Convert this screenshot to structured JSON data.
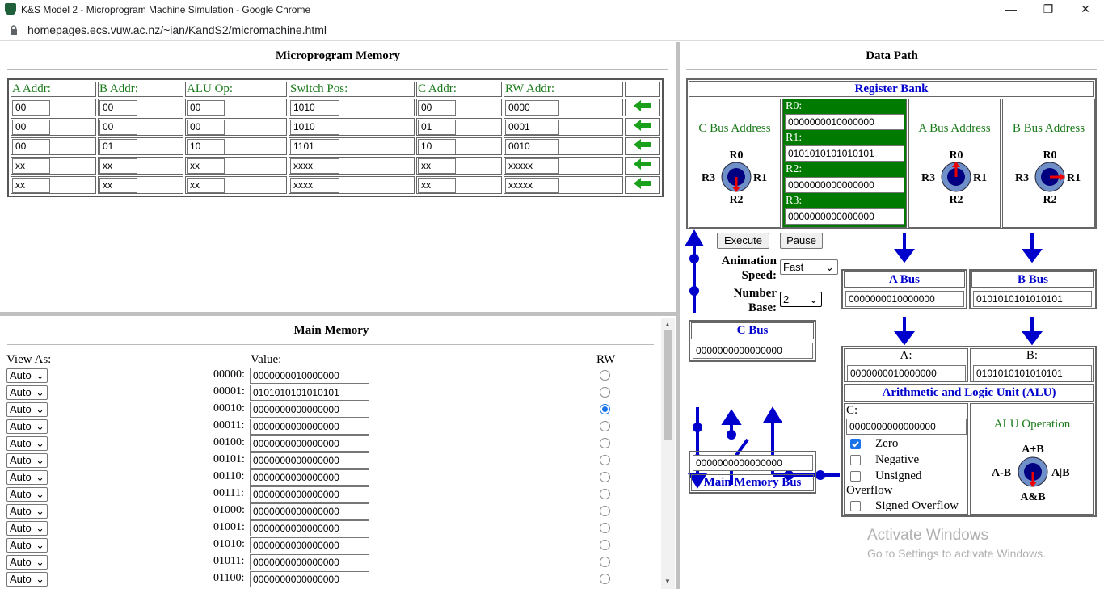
{
  "window": {
    "title": "K&S Model 2 - Microprogram Machine Simulation - Google Chrome",
    "url": "homepages.ecs.vuw.ac.nz/~ian/KandS2/micromachine.html"
  },
  "microprogram": {
    "title": "Microprogram Memory",
    "headers": [
      "A Addr:",
      "B Addr:",
      "ALU Op:",
      "Switch Pos:",
      "C Addr:",
      "RW Addr:"
    ],
    "rows": [
      [
        "00",
        "00",
        "00",
        "1010",
        "00",
        "0000"
      ],
      [
        "00",
        "00",
        "00",
        "1010",
        "01",
        "0001"
      ],
      [
        "00",
        "01",
        "10",
        "1101",
        "10",
        "0010"
      ],
      [
        "xx",
        "xx",
        "xx",
        "xxxx",
        "xx",
        "xxxxx"
      ],
      [
        "xx",
        "xx",
        "xx",
        "xxxx",
        "xx",
        "xxxxx"
      ]
    ]
  },
  "main_memory": {
    "title": "Main Memory",
    "view_as_label": "View As:",
    "value_label": "Value:",
    "rw_label": "RW",
    "rows": [
      {
        "view": "Auto",
        "addr": "00000:",
        "value": "0000000010000000",
        "rw": false
      },
      {
        "view": "Auto",
        "addr": "00001:",
        "value": "0101010101010101",
        "rw": false
      },
      {
        "view": "Auto",
        "addr": "00010:",
        "value": "0000000000000000",
        "rw": true
      },
      {
        "view": "Auto",
        "addr": "00011:",
        "value": "0000000000000000",
        "rw": false
      },
      {
        "view": "Auto",
        "addr": "00100:",
        "value": "0000000000000000",
        "rw": false
      },
      {
        "view": "Auto",
        "addr": "00101:",
        "value": "0000000000000000",
        "rw": false
      },
      {
        "view": "Auto",
        "addr": "00110:",
        "value": "0000000000000000",
        "rw": false
      },
      {
        "view": "Auto",
        "addr": "00111:",
        "value": "0000000000000000",
        "rw": false
      },
      {
        "view": "Auto",
        "addr": "01000:",
        "value": "0000000000000000",
        "rw": false
      },
      {
        "view": "Auto",
        "addr": "01001:",
        "value": "0000000000000000",
        "rw": false
      },
      {
        "view": "Auto",
        "addr": "01010:",
        "value": "0000000000000000",
        "rw": false
      },
      {
        "view": "Auto",
        "addr": "01011:",
        "value": "0000000000000000",
        "rw": false
      },
      {
        "view": "Auto",
        "addr": "01100:",
        "value": "0000000000000000",
        "rw": false
      }
    ]
  },
  "datapath": {
    "title": "Data Path",
    "register_bank": "Register Bank",
    "c_bus_address": "C Bus Address",
    "a_bus_address": "A Bus Address",
    "b_bus_address": "B Bus Address",
    "registers": [
      {
        "name": "R0:",
        "value": "0000000010000000"
      },
      {
        "name": "R1:",
        "value": "0101010101010101"
      },
      {
        "name": "R2:",
        "value": "0000000000000000"
      },
      {
        "name": "R3:",
        "value": "0000000000000000"
      }
    ],
    "dial_labels": {
      "top": "R0",
      "left": "R3",
      "right": "R1",
      "bottom": "R2"
    },
    "execute": "Execute",
    "pause": "Pause",
    "animation_speed_label_1": "Animation",
    "animation_speed_label_2": "Speed:",
    "animation_speed": "Fast",
    "number_base_label_1": "Number",
    "number_base_label_2": "Base:",
    "number_base": "2",
    "a_bus": {
      "label": "A Bus",
      "value": "0000000010000000"
    },
    "b_bus": {
      "label": "B Bus",
      "value": "0101010101010101"
    },
    "c_bus": {
      "label": "C Bus",
      "value": "0000000000000000"
    },
    "main_memory_bus": {
      "label": "Main Memory Bus",
      "value": "0000000000000000"
    },
    "a_reg": {
      "label": "A:",
      "value": "0000000010000000"
    },
    "b_reg": {
      "label": "B:",
      "value": "0101010101010101"
    },
    "alu": {
      "title": "Arithmetic and Logic Unit (ALU)",
      "c_label": "C:",
      "c_value": "0000000000000000",
      "flags": [
        {
          "label": "Zero",
          "checked": true
        },
        {
          "label": "Negative",
          "checked": false
        },
        {
          "label": "Unsigned",
          "checked": false
        }
      ],
      "overflow_label": "Overflow",
      "signed_overflow": "Signed Overflow",
      "operation_label": "ALU Operation",
      "ops": {
        "top": "A+B",
        "left": "A-B",
        "right": "A|B",
        "bottom": "A&B"
      }
    }
  },
  "watermark": {
    "line1": "Activate Windows",
    "line2": "Go to Settings to activate Windows."
  },
  "colors": {
    "accent_blue": "#0000cc",
    "green": "#1a7a1a",
    "register_bg": "#007a00"
  }
}
